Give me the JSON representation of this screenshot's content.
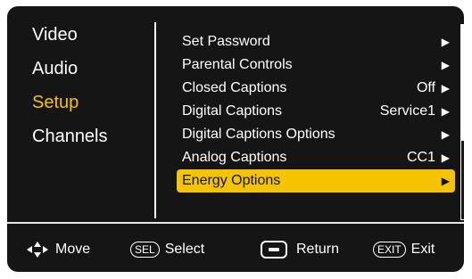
{
  "left_menu": {
    "items": [
      {
        "label": "Video",
        "active": false
      },
      {
        "label": "Audio",
        "active": false
      },
      {
        "label": "Setup",
        "active": true
      },
      {
        "label": "Channels",
        "active": false
      }
    ]
  },
  "setup_menu": {
    "items": [
      {
        "label": "Set Password",
        "value": "",
        "arrow": "▶"
      },
      {
        "label": "Parental Controls",
        "value": "",
        "arrow": "▶"
      },
      {
        "label": "Closed Captions",
        "value": "Off",
        "arrow": "▶"
      },
      {
        "label": "Digital Captions",
        "value": "Service1",
        "arrow": "▶"
      },
      {
        "label": "Digital Captions Options",
        "value": "",
        "arrow": "▶"
      },
      {
        "label": "Analog Captions",
        "value": "CC1",
        "arrow": "▶"
      },
      {
        "label": "Energy Options",
        "value": "",
        "arrow": "▶",
        "selected": true
      }
    ]
  },
  "footer": {
    "move_label": "Move",
    "sel_key": "SEL",
    "select_label": "Select",
    "return_label": "Return",
    "exit_key": "EXIT",
    "exit_label": "Exit"
  },
  "colors": {
    "accent": "#f5c400",
    "background": "#151515",
    "text": "#ffffff"
  },
  "icons": {
    "move": "dpad-arrows-icon",
    "return": "return-button-icon",
    "submenu": "triangle-right-icon"
  }
}
